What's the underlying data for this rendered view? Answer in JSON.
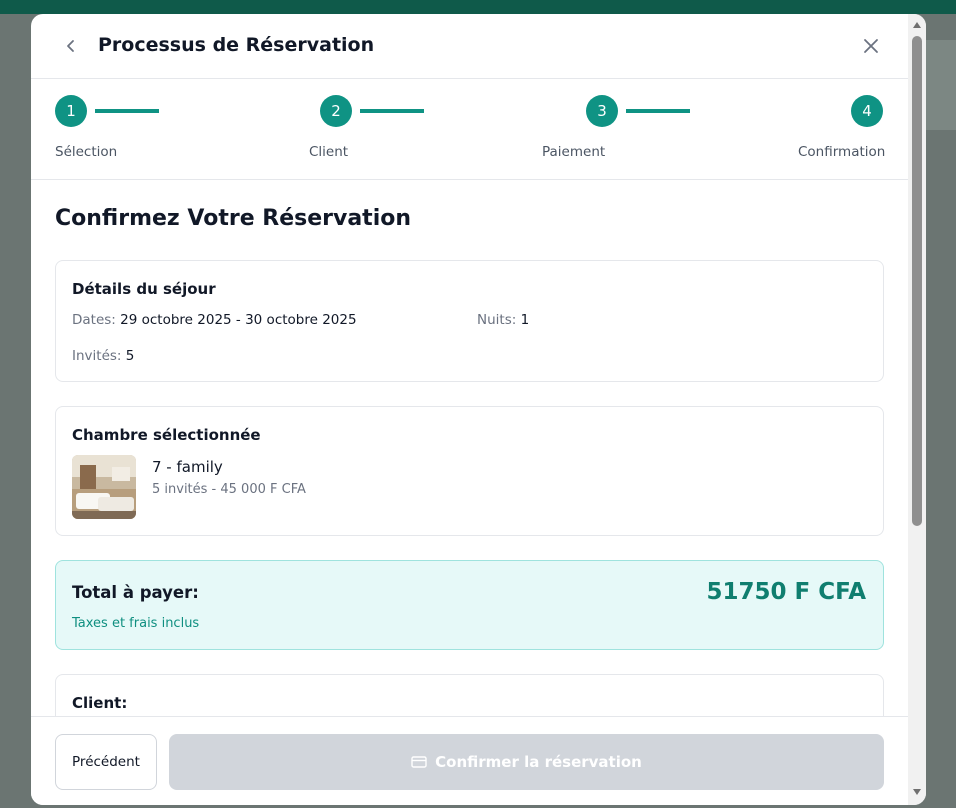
{
  "modal": {
    "title": "Processus de Réservation",
    "back_icon": "chevron-left-icon",
    "close_icon": "close-icon"
  },
  "steps": [
    {
      "number": "1",
      "label": "Sélection",
      "status": "complete"
    },
    {
      "number": "2",
      "label": "Client",
      "status": "complete"
    },
    {
      "number": "3",
      "label": "Paiement",
      "status": "complete"
    },
    {
      "number": "4",
      "label": "Confirmation",
      "status": "active"
    }
  ],
  "confirm": {
    "heading": "Confirmez Votre Réservation",
    "stay": {
      "title": "Détails du séjour",
      "dates_label": "Dates:",
      "dates_value": "29 octobre 2025 - 30 octobre 2025",
      "nights_label": "Nuits:",
      "nights_value": "1",
      "guests_label": "Invités:",
      "guests_value": "5"
    },
    "room": {
      "title": "Chambre sélectionnée",
      "name": "7 - family",
      "info": "5 invités - 45 000 F CFA"
    },
    "total": {
      "label": "Total à payer:",
      "amount": "51750 F CFA",
      "note": "Taxes et frais inclus"
    },
    "client": {
      "title": "Client:"
    }
  },
  "footer": {
    "prev_label": "Précédent",
    "confirm_label": "Confirmer la réservation",
    "confirm_icon": "credit-card-icon"
  },
  "colors": {
    "accent": "#0f9384",
    "total_bg": "#e6f9f8",
    "disabled_button": "#d1d5db"
  }
}
